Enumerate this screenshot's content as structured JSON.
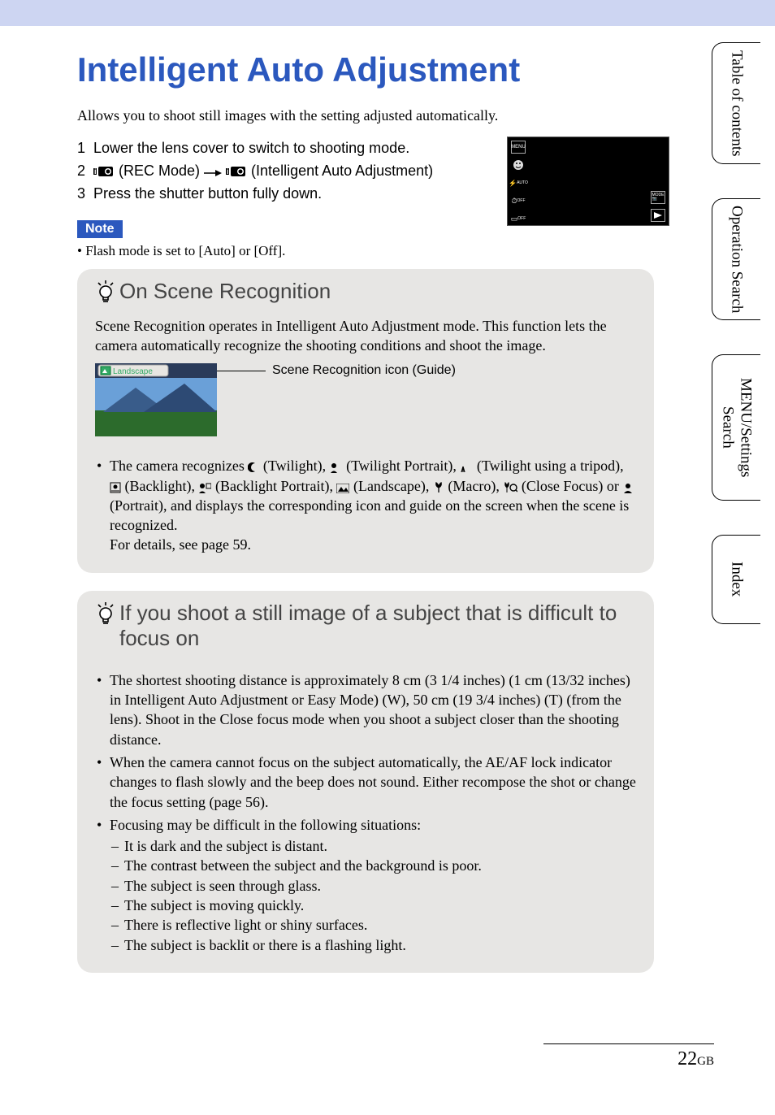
{
  "title": "Intelligent Auto Adjustment",
  "intro": "Allows you to shoot still images with the setting adjusted automatically.",
  "steps": {
    "s1": {
      "num": "1",
      "text": "Lower the lens cover to switch to shooting mode."
    },
    "s2": {
      "num": "2",
      "prefix": " (REC Mode) ",
      "arrow": "t",
      "suffix": " (Intelligent Auto Adjustment)"
    },
    "s3": {
      "num": "3",
      "text": "Press the shutter button fully down."
    }
  },
  "note": {
    "label": "Note",
    "text": "Flash mode is set to [Auto] or [Off]."
  },
  "tip1": {
    "title": "On Scene Recognition",
    "para": "Scene Recognition operates in Intelligent Auto Adjustment mode. This function lets the camera automatically recognize the shooting conditions and shoot the image.",
    "caption": "Scene Recognition icon (Guide)",
    "thumb_label": "Landscape",
    "bullet_pre": "The camera recognizes ",
    "scene_twilight": " (Twilight), ",
    "scene_twilight_portrait": " (Twilight Portrait), ",
    "scene_twilight_tripod": " (Twilight using a tripod), ",
    "scene_backlight": " (Backlight), ",
    "scene_backlight_portrait": " (Backlight Portrait), ",
    "scene_landscape": " (Landscape), ",
    "scene_macro": " (Macro), ",
    "scene_close_focus": " (Close Focus) or ",
    "scene_portrait": " (Portrait), and displays the corresponding icon and guide on the screen when the scene is recognized.",
    "details": "For details, see page 59."
  },
  "tip2": {
    "title": "If you shoot a still image of a subject that is difficult to focus on",
    "b1": "The shortest shooting distance is approximately 8 cm (3 1/4 inches) (1 cm (13/32 inches) in Intelligent Auto Adjustment or Easy Mode) (W), 50 cm (19 3/4 inches) (T) (from the lens). Shoot in the Close focus mode when you shoot a subject closer than the shooting distance.",
    "b2": "When the camera cannot focus on the subject automatically, the AE/AF lock indicator changes to flash slowly and the beep does not sound. Either recompose the shot or change the focus setting (page 56).",
    "b3": "Focusing may be difficult in the following situations:",
    "s1": "It is dark and the subject is distant.",
    "s2": "The contrast between the subject and the background is poor.",
    "s3": "The subject is seen through glass.",
    "s4": "The subject is moving quickly.",
    "s5": "There is reflective light or shiny surfaces.",
    "s6": "The subject is backlit or there is a flashing light."
  },
  "camera_icons": {
    "menu": "MENU",
    "smile": "smile-icon",
    "flash": "flash-auto-icon",
    "timer": "timer-off-icon",
    "burst": "burst-off-icon",
    "mode": "mode-icon",
    "play": "play-icon"
  },
  "side": {
    "toc": "Table of contents",
    "op": "Operation Search",
    "menu": "MENU/Settings Search",
    "index": "Index"
  },
  "page": {
    "num": "22",
    "suffix": "GB"
  }
}
